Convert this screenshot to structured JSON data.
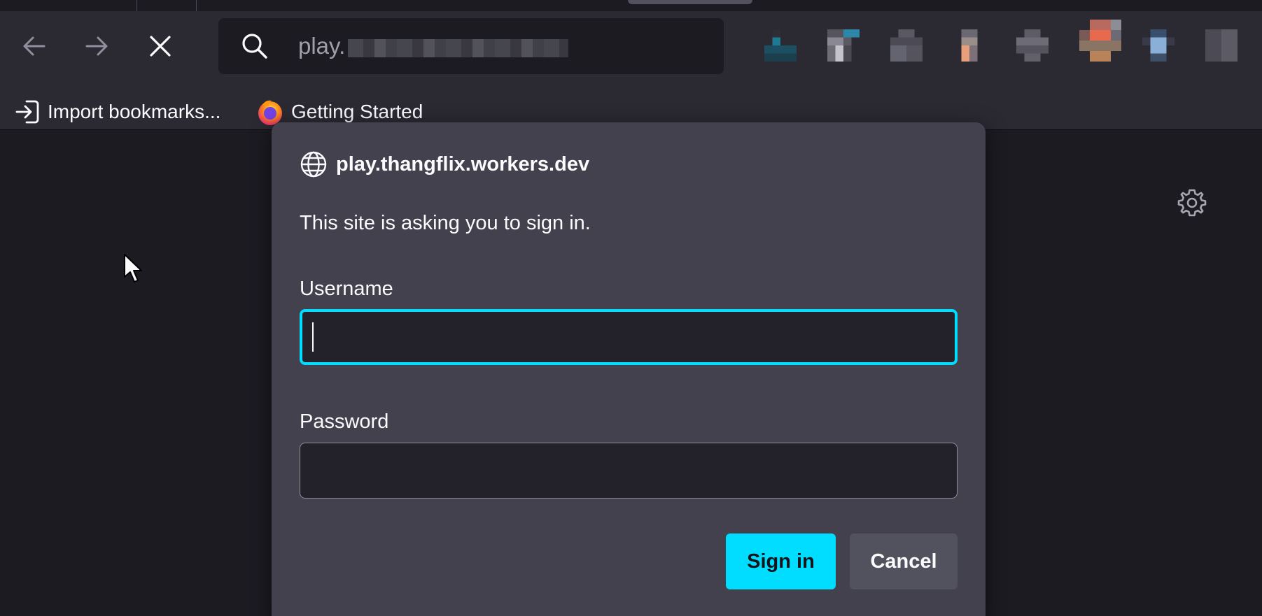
{
  "browser": {
    "url_visible_prefix": "play.",
    "bookmarks": [
      {
        "label": "Import bookmarks...",
        "icon": "import-icon"
      },
      {
        "label": "Getting Started",
        "icon": "firefox-icon"
      }
    ]
  },
  "dialog": {
    "origin": "play.thangflix.workers.dev",
    "prompt": "This site is asking you to sign in.",
    "username_label": "Username",
    "username_value": "",
    "password_label": "Password",
    "password_value": "",
    "signin_label": "Sign in",
    "cancel_label": "Cancel"
  },
  "colors": {
    "accent": "#00ddff",
    "dialog_bg": "#42414d",
    "toolbar_bg": "#2b2a33",
    "page_bg": "#1c1b22"
  }
}
